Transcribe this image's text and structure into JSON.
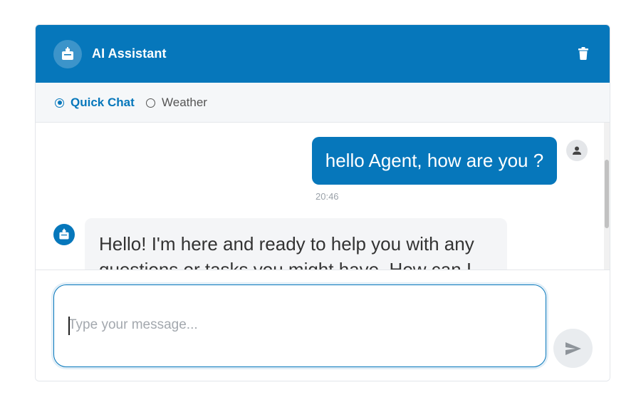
{
  "header": {
    "title": "AI Assistant",
    "avatar_icon": "robot-icon",
    "clear_icon": "trash-icon",
    "background_color": "#0677bb"
  },
  "tabs": [
    {
      "label": "Quick Chat",
      "selected": true
    },
    {
      "label": "Weather",
      "selected": false
    }
  ],
  "messages": [
    {
      "role": "user",
      "text": "hello Agent, how are you ?",
      "time": "20:46",
      "avatar_icon": "person-icon"
    },
    {
      "role": "assistant",
      "text": "Hello! I'm here and ready to help you with any questions or tasks you might have. How can I",
      "avatar_icon": "robot-icon"
    }
  ],
  "composer": {
    "placeholder": "Type your message...",
    "value": "",
    "send_icon": "send-icon"
  },
  "colors": {
    "accent": "#0677bb",
    "bot_bubble": "#f4f5f7",
    "send_button": "#e9ecef"
  }
}
